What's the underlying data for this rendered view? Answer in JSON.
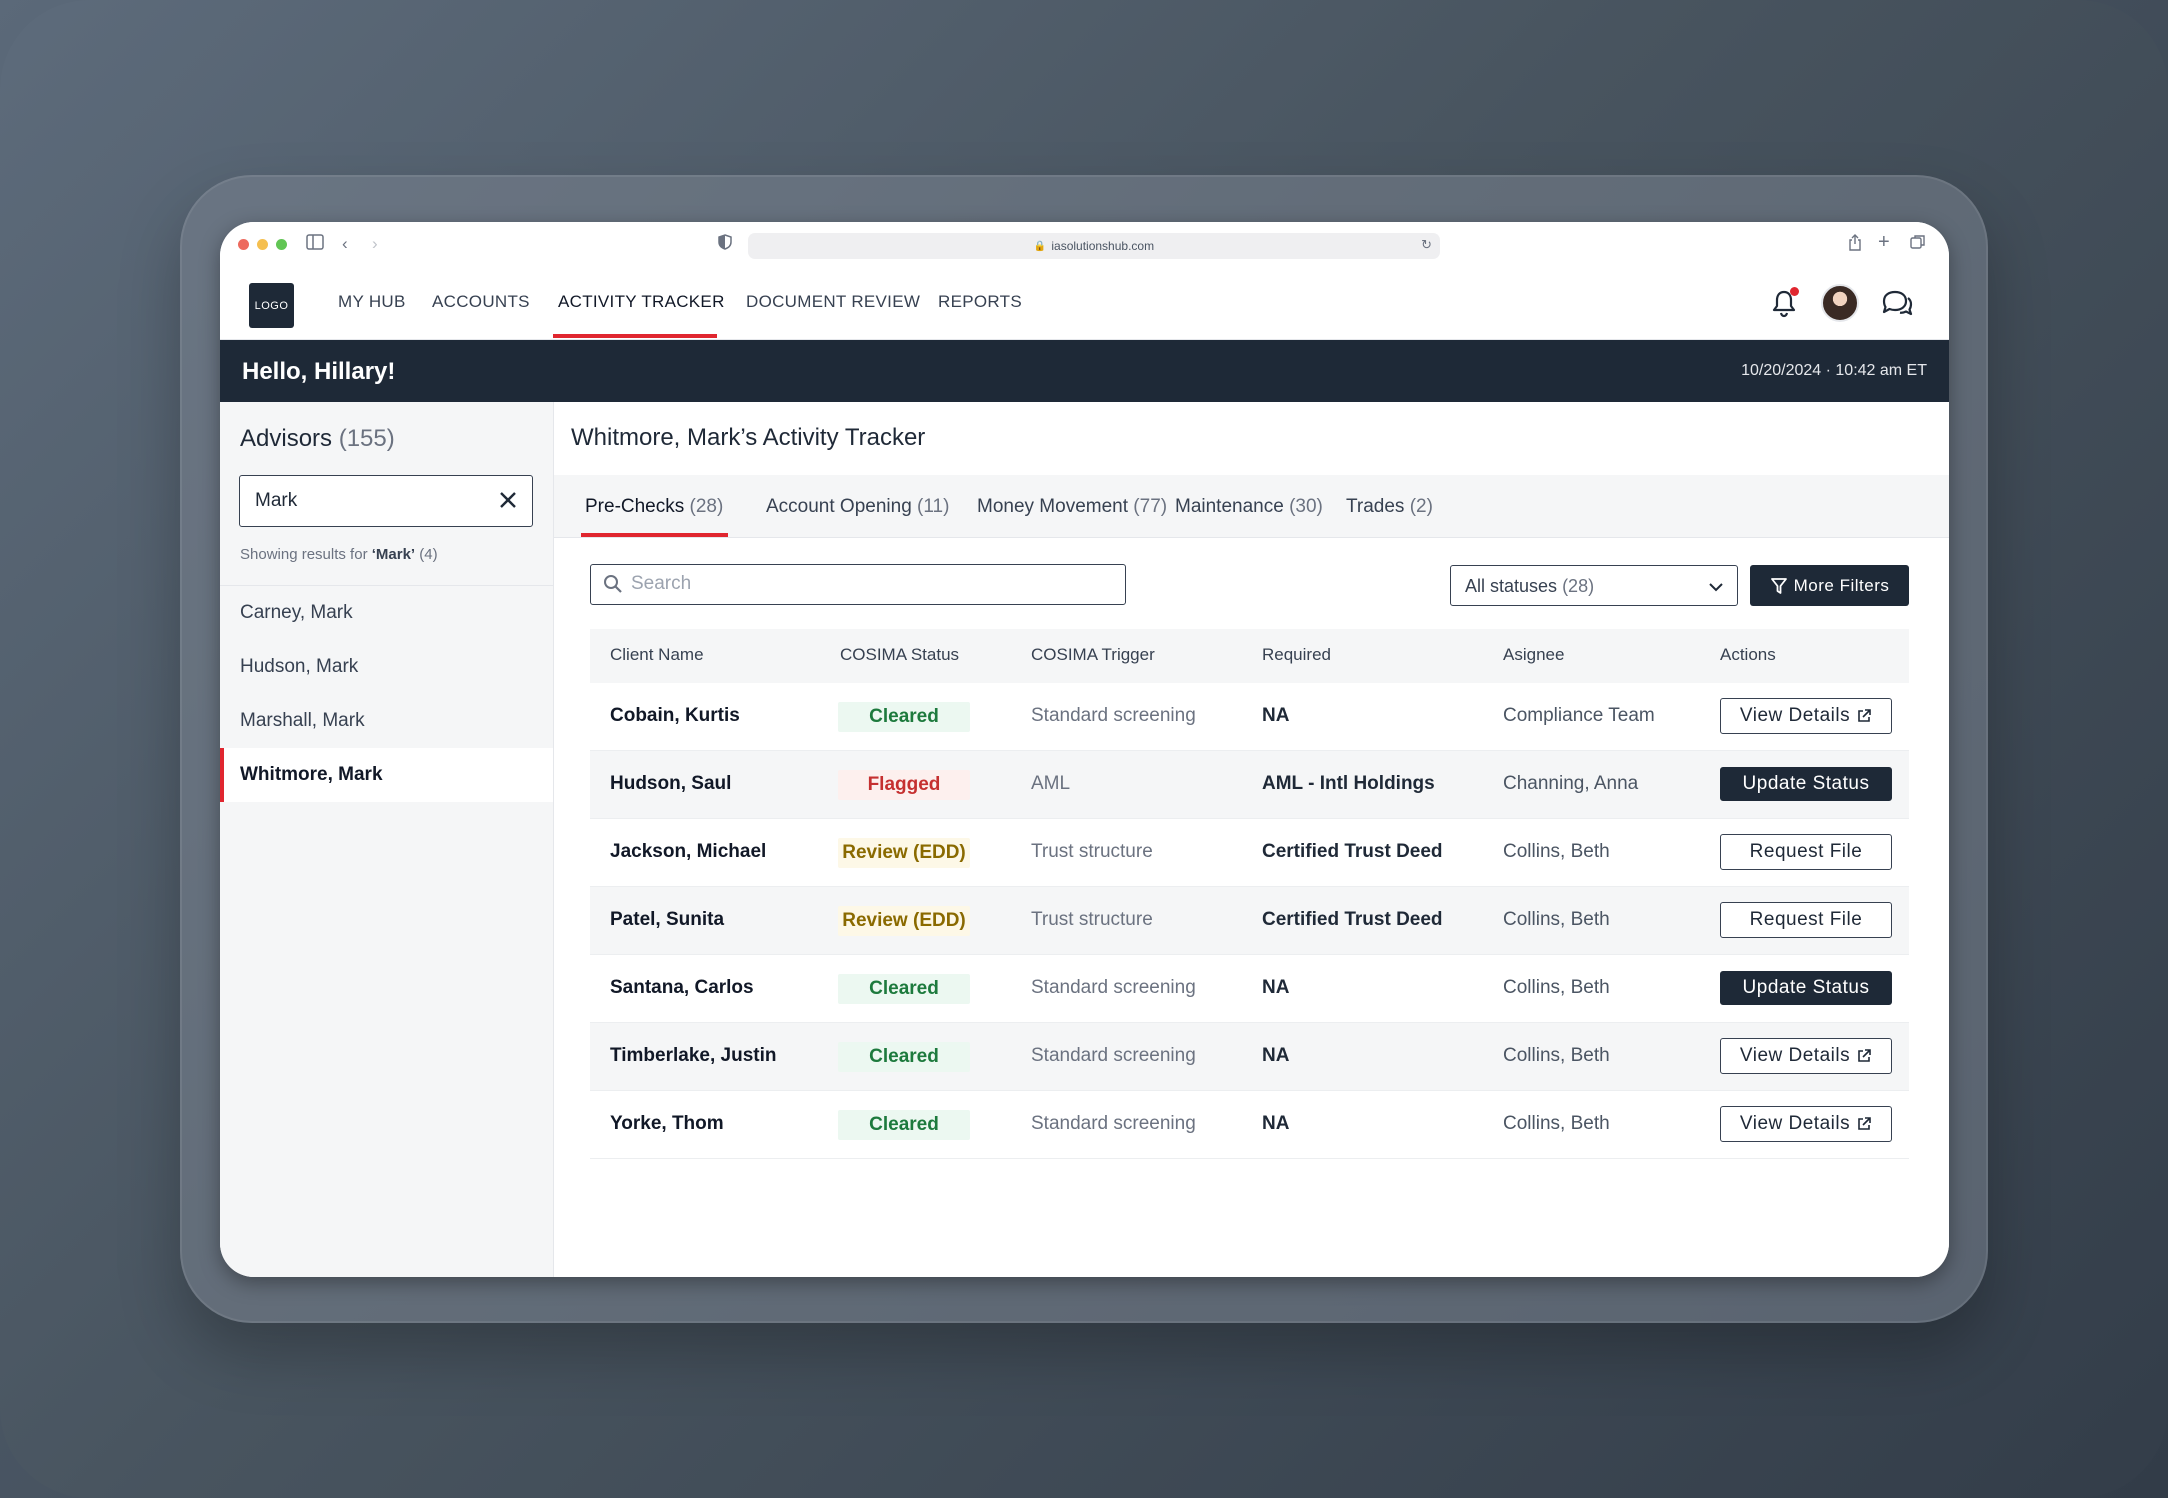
{
  "browser": {
    "url": "iasolutionshub.com"
  },
  "topnav": {
    "logo": "LOGO",
    "items": [
      {
        "label": "MY HUB"
      },
      {
        "label": "ACCOUNTS"
      },
      {
        "label": "ACTIVITY TRACKER",
        "active": true
      },
      {
        "label": "DOCUMENT REVIEW"
      },
      {
        "label": "REPORTS"
      }
    ],
    "icons": [
      "bell-icon",
      "avatar",
      "chat-icon"
    ]
  },
  "banner": {
    "greeting": "Hello, Hillary!",
    "datetime": "10/20/2024 · 10:42 am ET"
  },
  "sidebar": {
    "title": "Advisors",
    "count": "(155)",
    "search_value": "Mark",
    "results_prefix": "Showing results for ",
    "results_query": "‘Mark’",
    "results_count": "(4)",
    "advisors": [
      {
        "name": "Carney, Mark"
      },
      {
        "name": "Hudson, Mark"
      },
      {
        "name": "Marshall, Mark"
      },
      {
        "name": "Whitmore, Mark",
        "selected": true
      }
    ]
  },
  "main": {
    "title": "Whitmore, Mark’s Activity Tracker",
    "tabs": [
      {
        "label": "Pre-Checks",
        "count": "(28)",
        "active": true
      },
      {
        "label": "Account Opening",
        "count": "(11)"
      },
      {
        "label": "Money Movement",
        "count": "(77)"
      },
      {
        "label": "Maintenance",
        "count": "(30)"
      },
      {
        "label": "Trades",
        "count": "(2)"
      }
    ],
    "search_placeholder": "Search",
    "status_filter": {
      "label": "All statuses",
      "count": "(28)"
    },
    "more_filters_label": "More Filters",
    "table": {
      "headers": [
        "Client Name",
        "COSIMA Status",
        "COSIMA Trigger",
        "Required",
        "Asignee",
        "Actions"
      ],
      "rows": [
        {
          "client": "Cobain, Kurtis",
          "status": "Cleared",
          "trigger": "Standard screening",
          "required": "NA",
          "assignee": "Compliance Team",
          "action": "View Details"
        },
        {
          "client": "Hudson, Saul",
          "status": "Flagged",
          "trigger": "AML",
          "required": "AML - Intl Holdings",
          "assignee": "Channing, Anna",
          "action": "Update Status"
        },
        {
          "client": "Jackson, Michael",
          "status": "Review (EDD)",
          "trigger": "Trust structure",
          "required": "Certified Trust Deed",
          "assignee": "Collins, Beth",
          "action": "Request File"
        },
        {
          "client": "Patel, Sunita",
          "status": "Review (EDD)",
          "trigger": "Trust structure",
          "required": "Certified Trust Deed",
          "assignee": "Collins, Beth",
          "action": "Request File"
        },
        {
          "client": "Santana, Carlos",
          "status": "Cleared",
          "trigger": "Standard screening",
          "required": "NA",
          "assignee": "Collins, Beth",
          "action": "Update Status"
        },
        {
          "client": "Timberlake, Justin",
          "status": "Cleared",
          "trigger": "Standard screening",
          "required": "NA",
          "assignee": "Collins, Beth",
          "action": "View Details"
        },
        {
          "client": "Yorke, Thom",
          "status": "Cleared",
          "trigger": "Standard screening",
          "required": "NA",
          "assignee": "Collins, Beth",
          "action": "View Details"
        }
      ]
    }
  },
  "colors": {
    "accent": "#e0262f",
    "navy": "#1e2937",
    "cleared": "#1d7a3d",
    "flagged": "#c53030",
    "review": "#8a6a00"
  }
}
